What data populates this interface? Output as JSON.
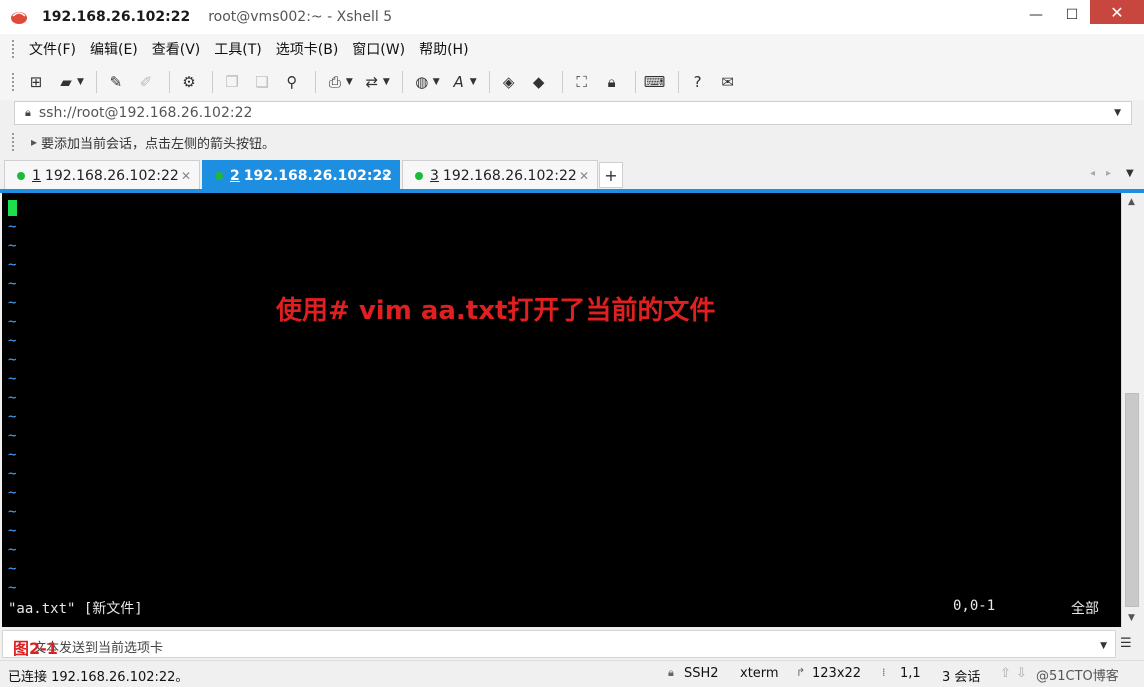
{
  "window": {
    "title_main": "192.168.26.102:22",
    "title_sub": "root@vms002:~ - Xshell 5",
    "minimize": "—",
    "maximize": "☐",
    "close": "✕"
  },
  "menu": [
    "文件(F)",
    "编辑(E)",
    "查看(V)",
    "工具(T)",
    "选项卡(B)",
    "窗口(W)",
    "帮助(H)"
  ],
  "toolbar_icons": [
    "new-session-icon",
    "open-folder-icon",
    "connect-icon",
    "disconnect-icon",
    "properties-icon",
    "copy-icon",
    "paste-icon",
    "find-icon",
    "print-icon",
    "transfer-icon",
    "globe-icon",
    "font-icon",
    "xftp-icon",
    "xmanager-icon",
    "fullscreen-icon",
    "lock-icon",
    "keyboard-icon",
    "help-icon",
    "chat-icon"
  ],
  "address": {
    "value": "ssh://root@192.168.26.102:22"
  },
  "hint": {
    "text": "要添加当前会话，点击左侧的箭头按钮。"
  },
  "tabs": [
    {
      "num": "1",
      "label": "192.168.26.102:22",
      "active": false
    },
    {
      "num": "2",
      "label": "192.168.26.102:22",
      "active": true
    },
    {
      "num": "3",
      "label": "192.168.26.102:22",
      "active": false
    }
  ],
  "tab_add": "+",
  "terminal": {
    "tilde": "~",
    "annotation": "使用# vim aa.txt打开了当前的文件",
    "status_file": "\"aa.txt\" [新文件]",
    "status_pos": "0,0-1",
    "status_pct": "全部"
  },
  "input_bar": {
    "figure_label": "图2-1",
    "placeholder": "文本发送到当前选项卡"
  },
  "statusbar": {
    "connection": "已连接 192.168.26.102:22。",
    "protocol": "SSH2",
    "term": "xterm",
    "size": "123x22",
    "cursor": "1,1",
    "sessions": "3 会话",
    "watermark": "@51CTO博客"
  }
}
